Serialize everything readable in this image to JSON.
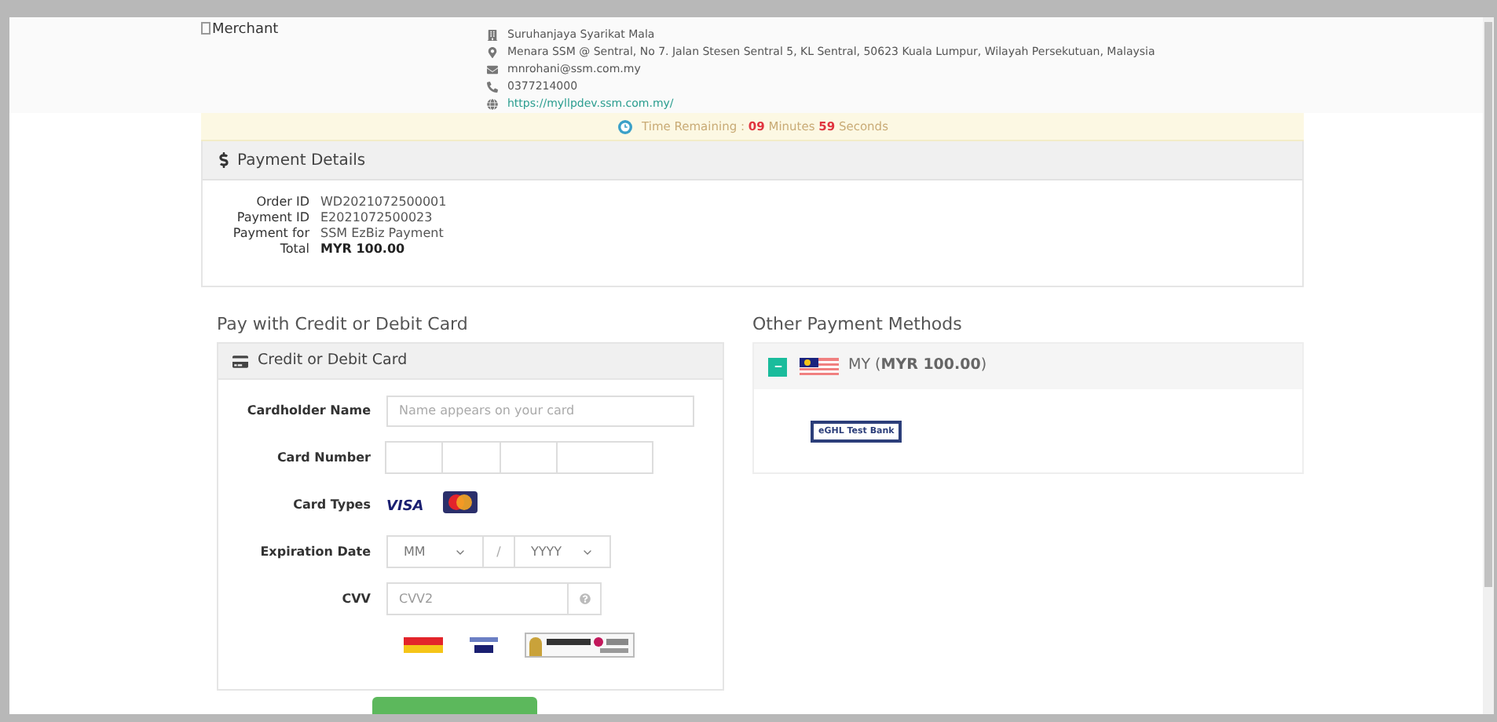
{
  "merchant": {
    "logo_alt": "Merchant",
    "name": "Suruhanjaya Syarikat Mala",
    "address": "Menara SSM @ Sentral, No 7. Jalan Stesen Sentral 5, KL Sentral, 50623 Kuala Lumpur, Wilayah Persekutuan, Malaysia",
    "email": "mnrohani@ssm.com.my",
    "phone": "0377214000",
    "website": "https://myllpdev.ssm.com.my/"
  },
  "timer": {
    "label": "Time Remaining :",
    "minutes": "09",
    "minutes_label": "Minutes",
    "seconds": "59",
    "seconds_label": "Seconds"
  },
  "payment_details": {
    "title": "Payment Details",
    "rows": [
      {
        "label": "Order ID",
        "value": "WD2021072500001",
        "bold": false
      },
      {
        "label": "Payment ID",
        "value": "E2021072500023",
        "bold": false
      },
      {
        "label": "Payment for",
        "value": "SSM EzBiz Payment",
        "bold": false
      },
      {
        "label": "Total",
        "value": "MYR 100.00",
        "bold": true
      }
    ]
  },
  "card_section": {
    "title": "Pay with Credit or Debit Card",
    "panel_title": "Credit or Debit Card",
    "cardholder": {
      "label": "Cardholder Name",
      "placeholder": "Name appears on your card"
    },
    "card_number": {
      "label": "Card Number"
    },
    "card_types": {
      "label": "Card Types",
      "visa": "VISA"
    },
    "expiration": {
      "label": "Expiration Date",
      "month": "MM",
      "separator": "/",
      "year": "YYYY"
    },
    "cvv": {
      "label": "CVV",
      "placeholder": "CVV2"
    }
  },
  "other_methods": {
    "title": "Other Payment Methods",
    "expanded": true,
    "country": "MY (**MYR 100.00**)",
    "banks": [
      "eGHL Test Bank"
    ]
  }
}
